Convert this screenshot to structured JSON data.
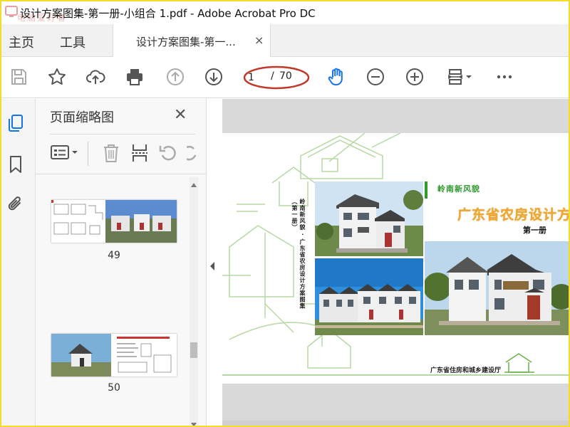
{
  "window": {
    "title": "设计方案图集-第一册-小组合 1.pdf - Adobe Acrobat Pro DC",
    "watermark": "电脑爱好者"
  },
  "tabs": {
    "home": "主页",
    "tools": "工具",
    "document": "设计方案图集-第一...",
    "document_close": "×"
  },
  "toolbar": {
    "page_current": "1",
    "page_separator": "/",
    "page_total": "70",
    "icons": [
      "save-icon",
      "star-icon",
      "cloud-upload-icon",
      "print-icon",
      "page-up-icon",
      "page-down-icon",
      "hand-icon",
      "zoom-out-icon",
      "zoom-in-icon",
      "page-fit-icon",
      "more-icon"
    ],
    "active_tool": "hand-icon",
    "accent": "#1473e6",
    "annotation_color": "#c0392b"
  },
  "left_rail": {
    "icons": [
      "page-thumbnails-icon",
      "bookmark-icon",
      "attachment-icon"
    ],
    "active": "page-thumbnails-icon"
  },
  "thumbnails_panel": {
    "title": "页面缩略图",
    "close": "✕",
    "tools": [
      "options-icon",
      "trash-icon",
      "insert-pages-icon",
      "undo-icon",
      "redo-icon"
    ],
    "pages": [
      {
        "number": "49"
      },
      {
        "number": "50"
      }
    ]
  },
  "document": {
    "vertical_caption": "岭南新风貌 · 广东省农房设计方案图集（第一册）",
    "series_label": "岭南新风貌",
    "main_title": "广东省农房设计方",
    "volume": "第一册",
    "publisher": "广东省住房和城乡建设厅",
    "title_color": "#f0a830",
    "series_color": "#2f9a2f"
  }
}
